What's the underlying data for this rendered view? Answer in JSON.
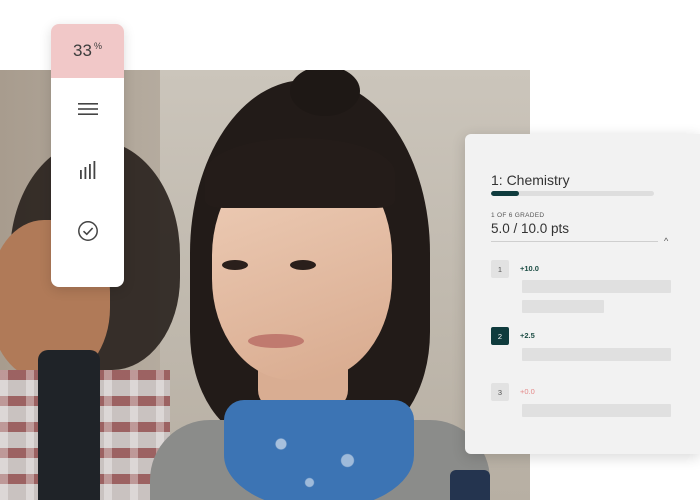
{
  "toolbar": {
    "percent_value": "33",
    "percent_unit": "%",
    "tools": [
      {
        "icon": "menu-icon"
      },
      {
        "icon": "bar-chart-icon"
      },
      {
        "icon": "check-circle-icon"
      }
    ]
  },
  "panel": {
    "title": "1: Chemistry",
    "progress_fraction": 0.17,
    "graded_text": "1 OF 6 GRADED",
    "points_text": "5.0 / 10.0 pts",
    "collapse_icon": "^",
    "questions": [
      {
        "number": "1",
        "score": "+10.0"
      },
      {
        "number": "2",
        "score": "+2.5"
      },
      {
        "number": "3",
        "score": "+0.0"
      }
    ]
  },
  "colors": {
    "accent_dark_teal": "#0f3b3d",
    "percent_badge_bg": "#f1c8c8",
    "zero_score": "#e58a8a"
  }
}
